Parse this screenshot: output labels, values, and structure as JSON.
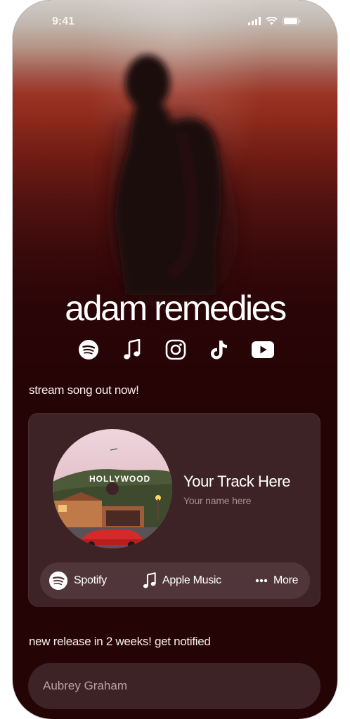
{
  "status_bar": {
    "time": "9:41"
  },
  "artist": {
    "name": "adam remedies"
  },
  "social_icons": [
    "spotify-icon",
    "music-note-icon",
    "instagram-icon",
    "tiktok-icon",
    "youtube-icon"
  ],
  "stream_section": {
    "label": "stream song out now!"
  },
  "track": {
    "title": "Your Track Here",
    "artist": "Your name here",
    "cover_sign": "HOLLYWOOD"
  },
  "platforms": [
    {
      "label": "Spotify",
      "icon": "spotify-icon"
    },
    {
      "label": "Apple Music",
      "icon": "music-note-icon"
    },
    {
      "label": "More",
      "icon": "more-dots-icon"
    }
  ],
  "notify_section": {
    "label": "new release in 2 weeks! get notified"
  },
  "signup": {
    "placeholder": "Aubrey Graham"
  },
  "colors": {
    "background": "#250406",
    "card": "#3d2325",
    "pill": "#50363a",
    "accent_red": "#9a3424"
  }
}
